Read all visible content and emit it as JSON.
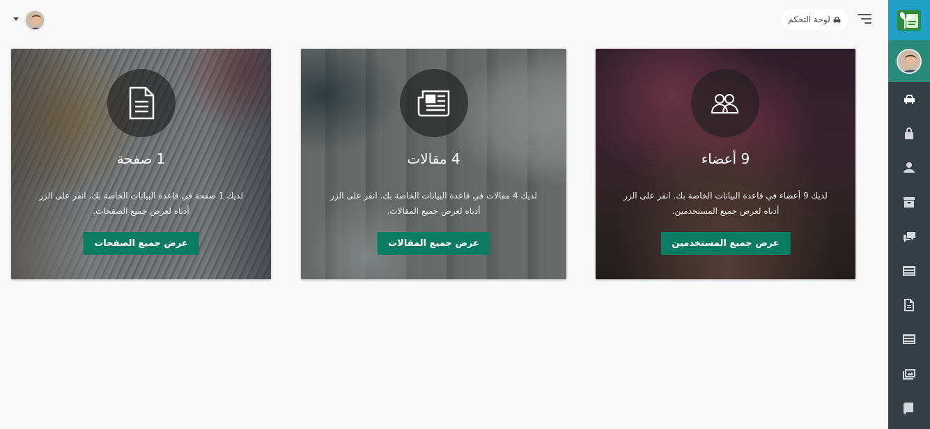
{
  "colors": {
    "sidebar_bg": "#353d47",
    "logo_bg": "#20a0c7",
    "user_bg": "#2a8a7a",
    "button_bg": "#0b7b62",
    "page_bg": "#f8f8f8"
  },
  "topbar": {
    "breadcrumb_label": "لوحة التحكم",
    "breadcrumb_icon": "dashboard-icon",
    "menu_icon": "hamburger-icon"
  },
  "sidebar": {
    "logo_icon": "sprout-logo",
    "items": [
      {
        "icon": "dashboard-icon",
        "active": true
      },
      {
        "icon": "lock-icon"
      },
      {
        "icon": "user-icon"
      },
      {
        "icon": "archive-icon"
      },
      {
        "icon": "comments-icon"
      },
      {
        "icon": "list-icon"
      },
      {
        "icon": "document-icon"
      },
      {
        "icon": "list-icon"
      },
      {
        "icon": "images-icon"
      },
      {
        "icon": "book-icon"
      }
    ]
  },
  "cards": {
    "users": {
      "icon": "users-icon",
      "title": "9 أعضاء",
      "description": "لديك 9 أعضاء في قاعدة البيانات الخاصة بك. انقر على الزر أدناه لعرض جميع المستخدمين.",
      "button": "عرض جميع المستخدمين"
    },
    "articles": {
      "icon": "newspaper-icon",
      "title": "4 مقالات",
      "description": "لديك 4 مقالات في قاعدة البيانات الخاصة بك. انقر على الزر أدناه لعرض جميع المقالات.",
      "button": "عرض جميع المقالات"
    },
    "pages": {
      "icon": "file-text-icon",
      "title": "1 صفحة",
      "description": "لديك 1 صفحة في قاعدة البيانات الخاصة بك. انقر على الزر أدناه لعرض جميع الصفحات.",
      "button": "عرض جميع الصفحات"
    }
  }
}
